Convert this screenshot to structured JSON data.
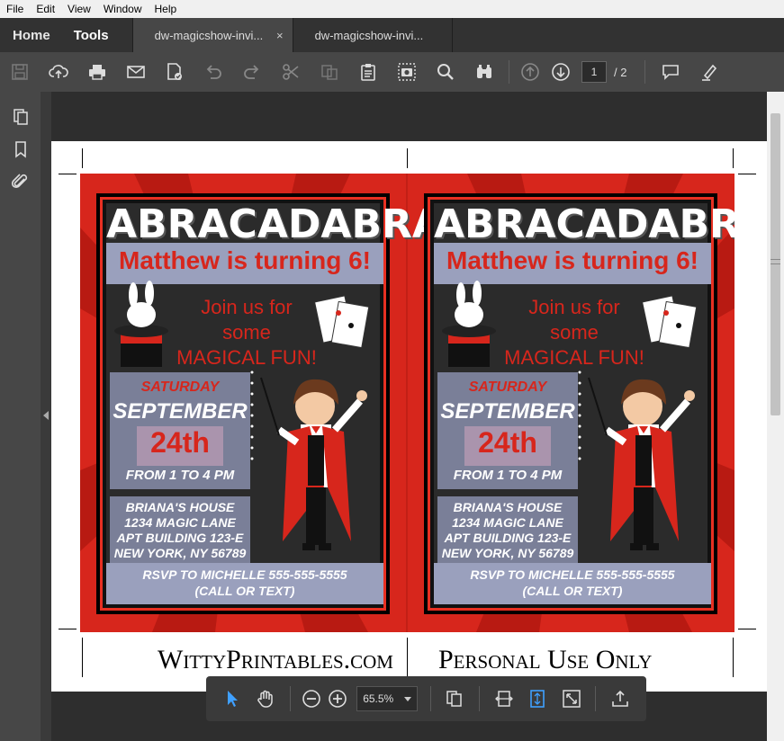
{
  "menu": [
    "File",
    "Edit",
    "View",
    "Window",
    "Help"
  ],
  "nav": {
    "home": "Home",
    "tools": "Tools"
  },
  "tabs": [
    {
      "label": "dw-magicshow-invi...",
      "close": "×"
    },
    {
      "label": "dw-magicshow-invi..."
    }
  ],
  "toolbar": {
    "icons": [
      "save-icon",
      "upload-icon",
      "print-icon",
      "email-icon",
      "edit-pdf-icon",
      "undo-icon",
      "redo-icon",
      "cut-icon",
      "copy-icon",
      "clipboard-icon",
      "snapshot-icon",
      "search-icon",
      "binoculars-icon",
      "page-up-icon",
      "page-down-icon",
      "comment-icon",
      "highlight-icon"
    ],
    "page_current": "1",
    "page_total": "/ 2"
  },
  "leftrail": [
    "pages-icon",
    "bookmark-icon",
    "attachment-icon"
  ],
  "invitation": {
    "title": "ABRACADABRA!",
    "headline": "Matthew is turning 6!",
    "join_line1": "Join us for some",
    "join_line2": "MAGICAL FUN!",
    "day": "SATURDAY",
    "month": "SEPTEMBER",
    "date": "24th",
    "time": "FROM 1 TO 4 PM",
    "addr1": "BRIANA'S HOUSE",
    "addr2": "1234 MAGIC LANE",
    "addr3": "APT BUILDING 123-E",
    "addr4": "NEW YORK, NY 56789",
    "rsvp1": "RSVP TO MICHELLE 555-555-5555",
    "rsvp2": "(CALL OR TEXT)"
  },
  "footer": {
    "left": "WittyPrintables.com",
    "right": "Personal Use Only"
  },
  "zoombar": {
    "zoom": "65.5%"
  },
  "colors": {
    "red": "#d7261c",
    "band": "#9aa0bd",
    "chrome": "#474747"
  }
}
